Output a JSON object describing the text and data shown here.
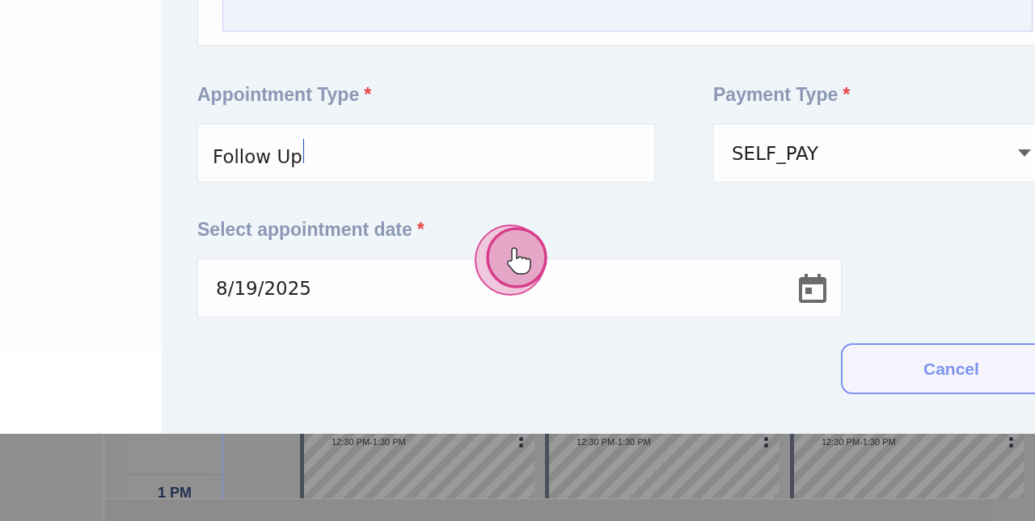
{
  "fields": [
    {
      "kind": "text",
      "label": "Appointment Type",
      "required_mark": "*",
      "value": "Follow Up",
      "focused": true
    },
    {
      "kind": "select",
      "label": "Payment Type",
      "required_mark": "*",
      "value": "SELF_PAY",
      "focused": false
    },
    {
      "kind": "date",
      "label": "Select appointment date",
      "required_mark": "*",
      "value": "8/19/2025",
      "focused": false
    }
  ],
  "buttons": [
    {
      "label": "Cancel"
    }
  ],
  "calendar": {
    "time_label": "1 PM",
    "events": [
      {
        "time": "12:30 PM-1:30 PM"
      },
      {
        "time": "12:30 PM-1:30 PM"
      },
      {
        "time": "12:30 PM-1:30 PM"
      }
    ]
  }
}
